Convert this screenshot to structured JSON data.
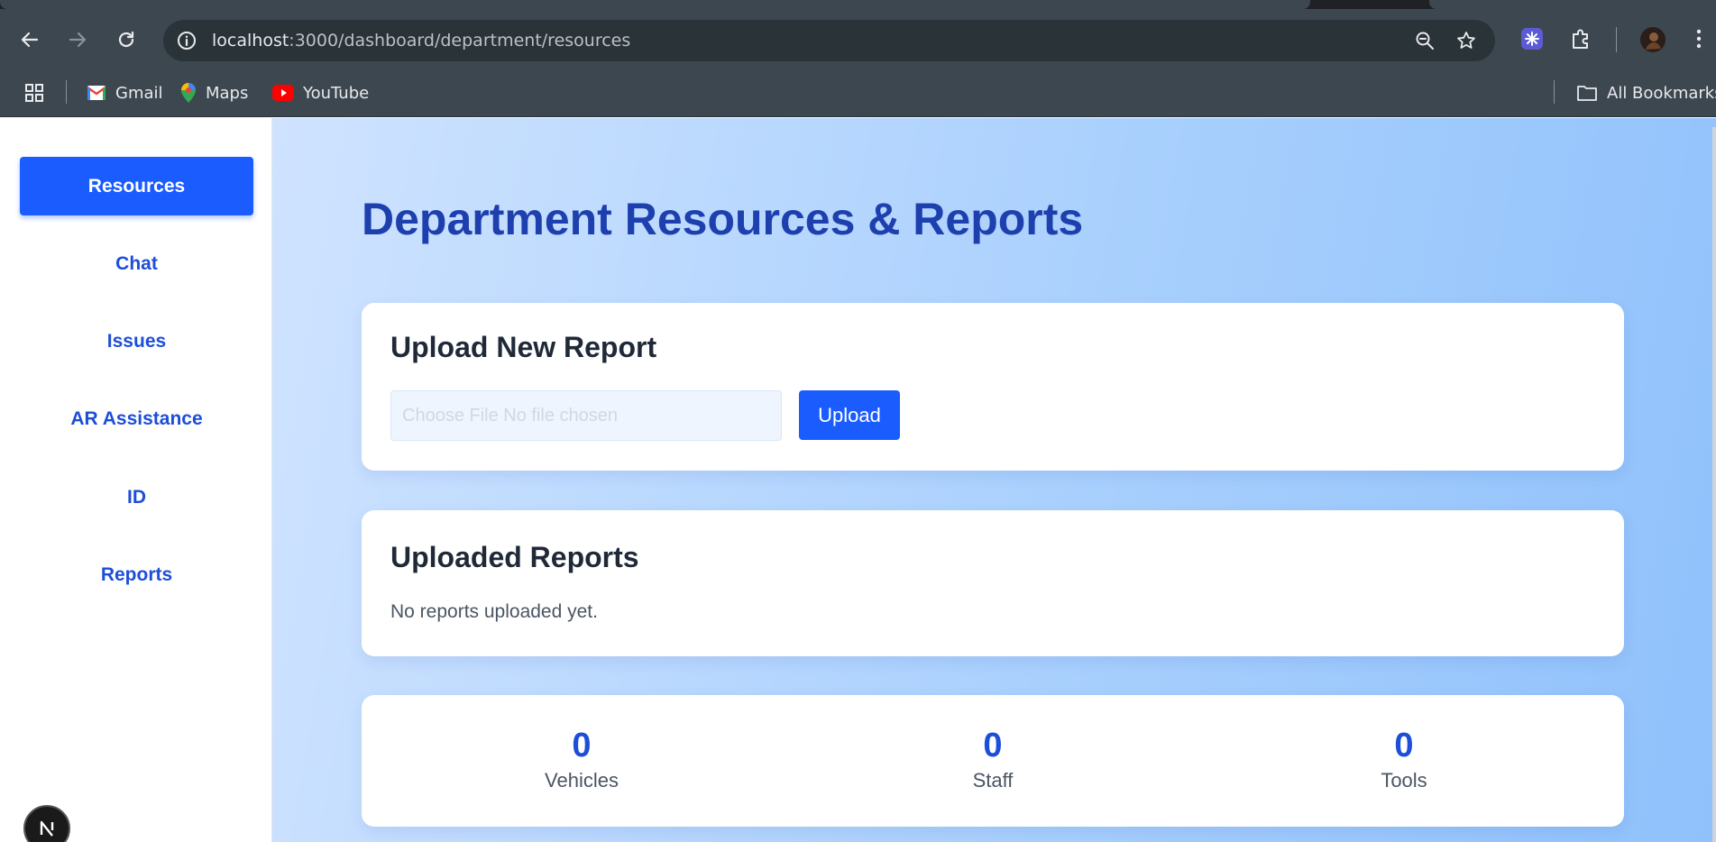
{
  "browser": {
    "url_host": "localhost",
    "url_path": ":3000/dashboard/department/resources",
    "bookmarks": [
      {
        "label": "Gmail"
      },
      {
        "label": "Maps"
      },
      {
        "label": "YouTube"
      }
    ],
    "all_bookmarks_label": "All Bookmarks"
  },
  "sidebar": {
    "items": [
      {
        "label": "Resources",
        "active": true
      },
      {
        "label": "Chat"
      },
      {
        "label": "Issues"
      },
      {
        "label": "AR Assistance"
      },
      {
        "label": "ID"
      },
      {
        "label": "Reports"
      }
    ]
  },
  "main": {
    "title": "Department Resources & Reports",
    "upload_card": {
      "heading": "Upload New Report",
      "file_input_text": "Choose File No file chosen",
      "upload_label": "Upload"
    },
    "reports_card": {
      "heading": "Uploaded Reports",
      "empty_text": "No reports uploaded yet."
    },
    "stats": [
      {
        "value": "0",
        "label": "Vehicles"
      },
      {
        "value": "0",
        "label": "Staff"
      },
      {
        "value": "0",
        "label": "Tools"
      }
    ]
  },
  "colors": {
    "accent": "#1b5cff",
    "heading_blue": "#1e40af",
    "link_blue": "#1d4ed8"
  }
}
